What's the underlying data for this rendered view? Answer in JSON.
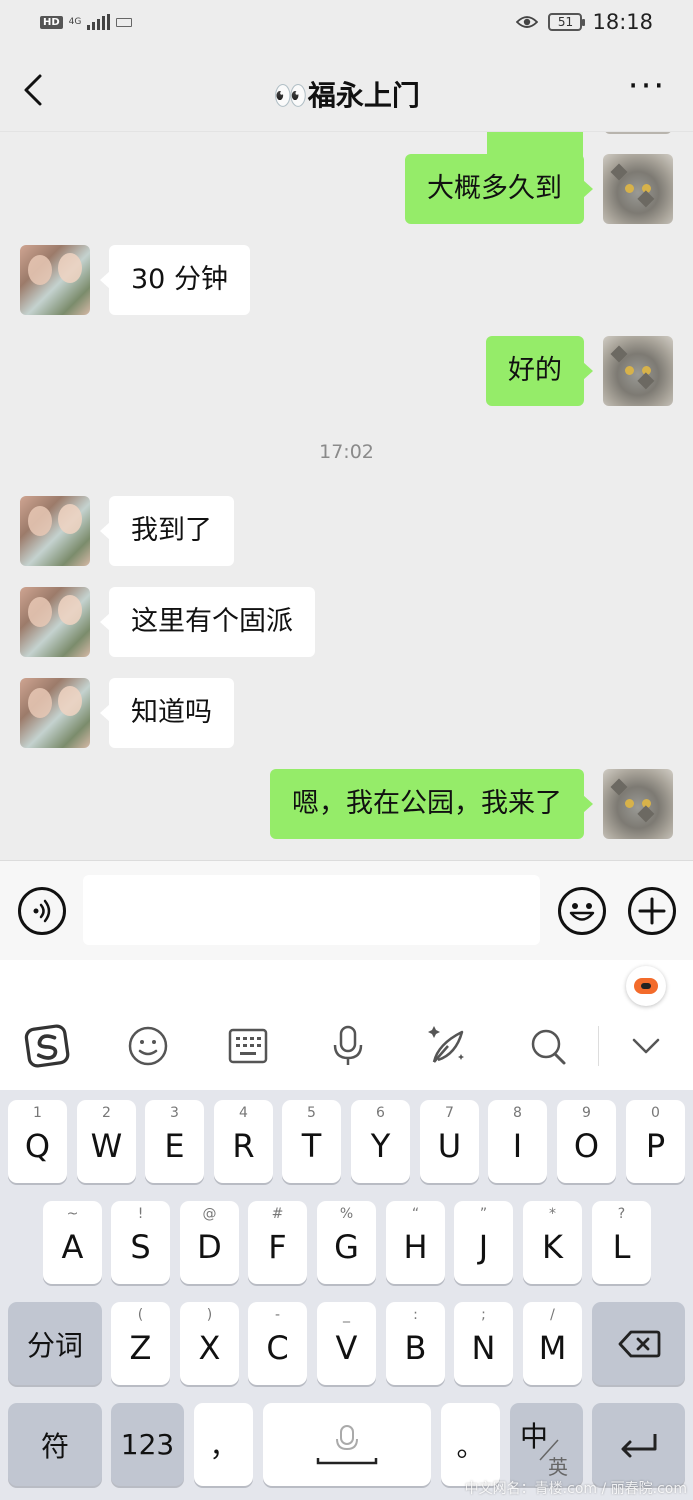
{
  "status_bar": {
    "hd": "HD",
    "network": "4G",
    "battery_level": "51",
    "time": "18:18"
  },
  "header": {
    "title": "👀福永上门",
    "more": "···"
  },
  "messages": [
    {
      "side": "out",
      "text": "大概多久到"
    },
    {
      "side": "in",
      "text": "30 分钟"
    },
    {
      "side": "out",
      "text": "好的"
    },
    {
      "side": "timestamp",
      "text": "17:02"
    },
    {
      "side": "in",
      "text": "我到了"
    },
    {
      "side": "in",
      "text": "这里有个固派"
    },
    {
      "side": "in",
      "text": "知道吗"
    },
    {
      "side": "out",
      "text": "嗯，我在公园，我来了"
    }
  ],
  "input_bar": {
    "placeholder": ""
  },
  "ime_toolbar": {
    "icons": [
      "sogou-logo-icon",
      "emoji-icon",
      "keyboard-icon",
      "microphone-icon",
      "handwriting-icon",
      "search-icon",
      "collapse-chevron-icon"
    ]
  },
  "keyboard": {
    "row1": [
      {
        "letter": "Q",
        "hint": "1"
      },
      {
        "letter": "W",
        "hint": "2"
      },
      {
        "letter": "E",
        "hint": "3"
      },
      {
        "letter": "R",
        "hint": "4"
      },
      {
        "letter": "T",
        "hint": "5"
      },
      {
        "letter": "Y",
        "hint": "6"
      },
      {
        "letter": "U",
        "hint": "7"
      },
      {
        "letter": "I",
        "hint": "8"
      },
      {
        "letter": "O",
        "hint": "9"
      },
      {
        "letter": "P",
        "hint": "0"
      }
    ],
    "row2": [
      {
        "letter": "A",
        "hint": "~"
      },
      {
        "letter": "S",
        "hint": "!"
      },
      {
        "letter": "D",
        "hint": "@"
      },
      {
        "letter": "F",
        "hint": "#"
      },
      {
        "letter": "G",
        "hint": "%"
      },
      {
        "letter": "H",
        "hint": "“"
      },
      {
        "letter": "J",
        "hint": "”"
      },
      {
        "letter": "K",
        "hint": "*"
      },
      {
        "letter": "L",
        "hint": "?"
      }
    ],
    "row3": [
      {
        "letter": "Z",
        "hint": "("
      },
      {
        "letter": "X",
        "hint": ")"
      },
      {
        "letter": "C",
        "hint": "-"
      },
      {
        "letter": "V",
        "hint": "_"
      },
      {
        "letter": "B",
        "hint": ":"
      },
      {
        "letter": "N",
        "hint": ";"
      },
      {
        "letter": "M",
        "hint": "/"
      }
    ],
    "fenci": "分词",
    "symbols": "符",
    "numbers": "123",
    "comma": "，",
    "period": "。",
    "lang_main": "中",
    "lang_alt": "英"
  },
  "watermark": "中文网名：青楼.com / 丽春院.com"
}
